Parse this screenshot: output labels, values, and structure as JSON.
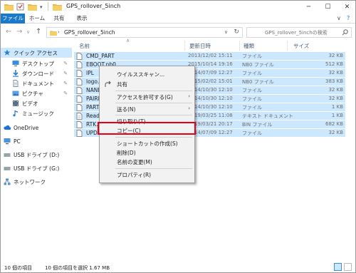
{
  "window": {
    "title": "GPS_rollover_5inch",
    "minimize": "─",
    "maximize": "☐",
    "close": "✕"
  },
  "ribbon": {
    "tabs": [
      "ファイル",
      "ホーム",
      "共有",
      "表示"
    ],
    "expand": "∨",
    "help": "?"
  },
  "address": {
    "back": "←",
    "forward": "→",
    "dropdown": "∨",
    "up": "↑",
    "separator": "›",
    "crumb": "GPS_rollover_5inch",
    "dd": "∨",
    "refresh": "↻",
    "search_placeholder": "GPS_rollover_5inchの検索"
  },
  "navpane": {
    "items": [
      {
        "label": "クイック アクセス",
        "icon": "star-icon",
        "pinned": false
      },
      {
        "label": "デスクトップ",
        "icon": "desktop-icon",
        "pinned": true
      },
      {
        "label": "ダウンロード",
        "icon": "download-icon",
        "pinned": true
      },
      {
        "label": "ドキュメント",
        "icon": "document-icon",
        "pinned": true
      },
      {
        "label": "ピクチャ",
        "icon": "pictures-icon",
        "pinned": true
      },
      {
        "label": "ビデオ",
        "icon": "video-icon",
        "pinned": false
      },
      {
        "label": "ミュージック",
        "icon": "music-icon",
        "pinned": false
      },
      {
        "label": "OneDrive",
        "icon": "cloud-icon",
        "pinned": false
      },
      {
        "label": "PC",
        "icon": "pc-icon",
        "pinned": false
      },
      {
        "label": "USB ドライブ (D:)",
        "icon": "usb-drive-icon",
        "pinned": false
      },
      {
        "label": "USB ドライブ (G:)",
        "icon": "usb-drive-icon",
        "pinned": false
      },
      {
        "label": "ネットワーク",
        "icon": "network-icon",
        "pinned": false
      }
    ],
    "pin_glyph": "✎"
  },
  "columns": {
    "name": "名前",
    "date": "更新日時",
    "type": "種類",
    "size": "サイズ",
    "sort": "∧"
  },
  "files": [
    {
      "name": "CMD_PART",
      "date": "2013/12/02 15:11",
      "type": "ファイル",
      "size": "32 KB"
    },
    {
      "name": "EBOOT.nb0",
      "date": "2015/10/14 19:16",
      "type": "NB0 ファイル",
      "size": "512 KB"
    },
    {
      "name": "IPL",
      "date": "2014/07/09 12:27",
      "type": "ファイル",
      "size": "32 KB"
    },
    {
      "name": "logo.nb0",
      "date": "2015/02/02 15:01",
      "type": "NB0 ファイル",
      "size": "383 KB"
    },
    {
      "name": "NAND",
      "date": "2014/10/30 12:10",
      "type": "ファイル",
      "size": "32 KB"
    },
    {
      "name": "PAIRPART",
      "date": "2014/10/30 12:10",
      "type": "ファイル",
      "size": "32 KB"
    },
    {
      "name": "PARTINFO",
      "date": "2014/10/30 12:10",
      "type": "ファイル",
      "size": "1 KB"
    },
    {
      "name": "ReadMe.txt",
      "date": "2019/03/25 11:08",
      "type": "テキスト ドキュメント",
      "size": "1 KB"
    },
    {
      "name": "RTK.bin",
      "date": "2019/03/21 20:17",
      "type": "BIN ファイル",
      "size": "682 KB"
    },
    {
      "name": "UPD",
      "date": "2014/07/09 12:27",
      "type": "ファイル",
      "size": "32 KB"
    }
  ],
  "context_menu": {
    "items": [
      {
        "label": "ウイルススキャン...",
        "icon": "",
        "arrow": ""
      },
      {
        "label": "共有",
        "icon": "share-icon",
        "arrow": ""
      },
      {
        "label": "アクセスを許可する(G)",
        "icon": "",
        "arrow": "›"
      },
      {
        "label": "送る(N)",
        "icon": "",
        "arrow": "›"
      },
      {
        "label": "切り取り(T)",
        "icon": "",
        "arrow": ""
      },
      {
        "label": "コピー(C)",
        "icon": "",
        "arrow": ""
      },
      {
        "label": "ショートカットの作成(S)",
        "icon": "",
        "arrow": ""
      },
      {
        "label": "削除(D)",
        "icon": "",
        "arrow": ""
      },
      {
        "label": "名前の変更(M)",
        "icon": "",
        "arrow": ""
      },
      {
        "label": "プロパティ(R)",
        "icon": "",
        "arrow": ""
      }
    ],
    "highlighted": "コピー(C)",
    "highlight_color": "#e60012"
  },
  "status": {
    "count": "10 個の項目",
    "selected": "10 個の項目を選択  1.67 MB"
  },
  "colors": {
    "accent": "#1979ca",
    "selection": "#cce8ff",
    "highlight": "#e60012"
  }
}
